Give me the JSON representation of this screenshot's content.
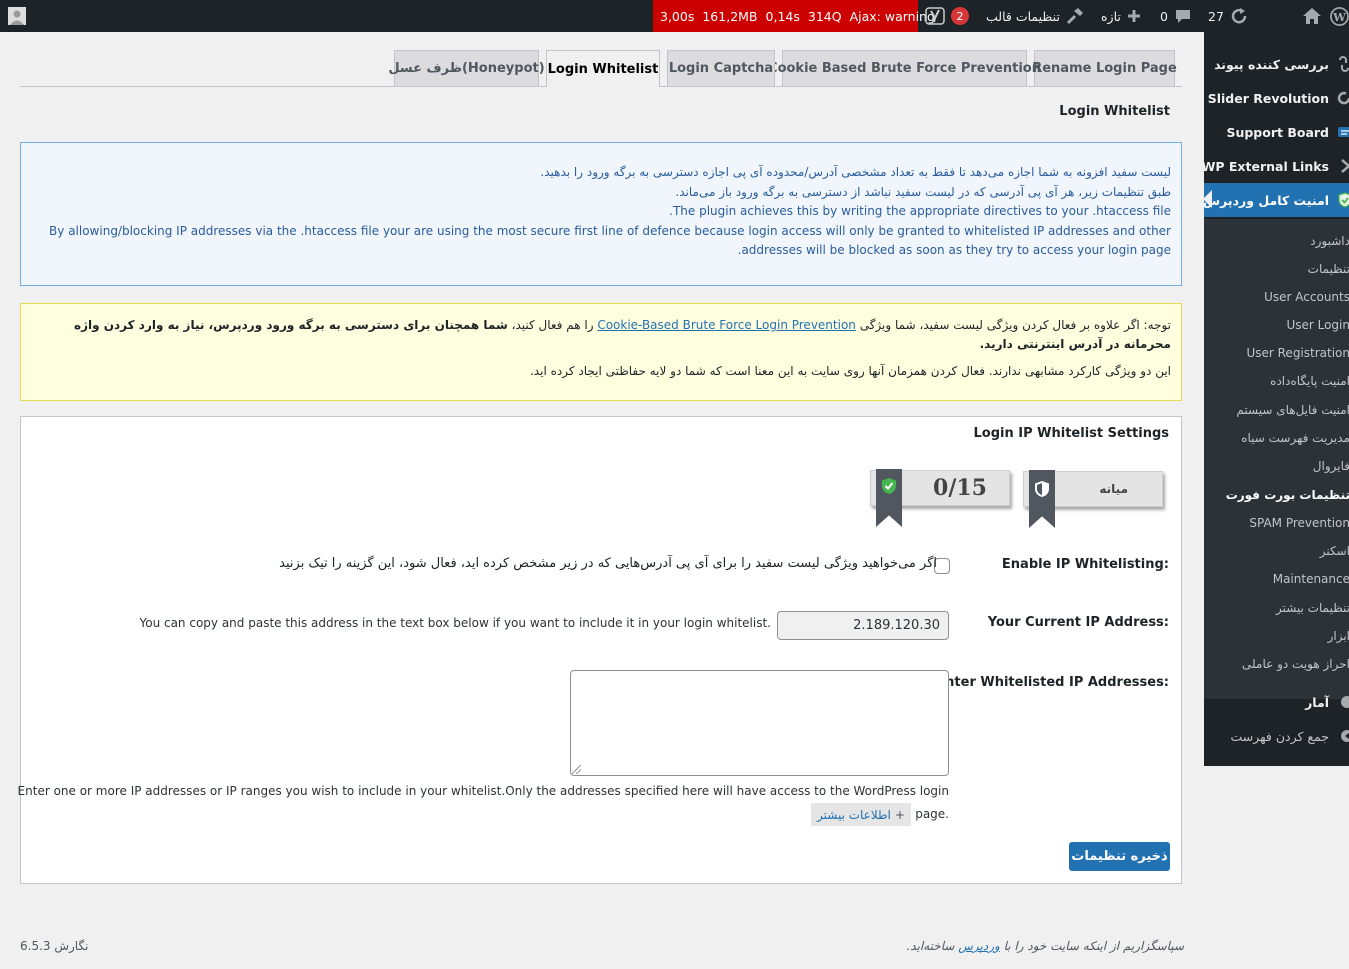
{
  "adminbar": {
    "user_icon": "user-avatar-icon",
    "qm": {
      "time": "3,00s",
      "memory": "161,2MB",
      "db_time": "0,14s",
      "queries": "314Q",
      "ajax": "Ajax: warning"
    },
    "yoast_count": "2",
    "theme_settings": "تنظیمات قالب",
    "new": "تازه",
    "comments_count": "0",
    "updates_count": "27"
  },
  "sidebar": {
    "items": [
      {
        "label": "بررسی کننده پیوند"
      },
      {
        "label": "Slider Revolution"
      },
      {
        "label": "Support Board"
      },
      {
        "label": "WP External Links"
      },
      {
        "label": "امنیت کامل وردپرس"
      }
    ],
    "submenu": [
      {
        "label": "داشبورد"
      },
      {
        "label": "تنظیمات"
      },
      {
        "label": "User Accounts"
      },
      {
        "label": "User Login"
      },
      {
        "label": "User Registration"
      },
      {
        "label": "امنیت پایگاه‌داده"
      },
      {
        "label": "امنیت فایل‌های سیستم"
      },
      {
        "label": "مدیریت فهرست سیاه"
      },
      {
        "label": "فایروال"
      },
      {
        "label": "تنظیمات بورت فورت"
      },
      {
        "label": "SPAM Prevention"
      },
      {
        "label": "اسکنر"
      },
      {
        "label": "Maintenance"
      },
      {
        "label": "تنظیمات بیشتر"
      },
      {
        "label": "ابزار"
      },
      {
        "label": "احراز هویت دو عاملی"
      }
    ],
    "bottom": [
      {
        "label": "آمار"
      },
      {
        "label": "جمع کردن فهرست"
      }
    ]
  },
  "tabs": [
    {
      "label": "Rename Login Page"
    },
    {
      "label": "Cookie Based Brute Force Prevention"
    },
    {
      "label": "Login Captcha"
    },
    {
      "label": "Login Whitelist"
    },
    {
      "label": "ظرف عسل(Honeypot)"
    }
  ],
  "section_title": "Login Whitelist",
  "info": {
    "line1": "لیست سفید افزونه به شما اجازه می‌دهد تا فقط به تعداد مشخصی آدرس/محدوده آی پی اجازه دسترسی به برگه ورود را بدهید.",
    "line2": "طبق تنظیمات زیر، هر آی پی آدرسی که در لیست سفید نباشد از دسترسی به برگه ورود باز می‌ماند.",
    "line3": "The plugin achieves this by writing the appropriate directives to your .htaccess file.",
    "line4": "By allowing/blocking IP addresses via the .htaccess file your are using the most secure first line of defence because login access will only be granted to whitelisted IP addresses and other addresses will be blocked as soon as they try to access your login page."
  },
  "note": {
    "prefix": "توجه: اگر علاوه بر فعال کردن ویژگی لیست سفید، شما ویژگی ",
    "link": "Cookie-Based Brute Force Login Prevention",
    "middle": " را هم فعال کنید، ",
    "bold": "شما همچنان برای دسترسی به برگه ورود وردپرس، نیاز به وارد کردن واژه محرمانه در آدرس اینترنتی دارید.",
    "line2": "این دو ویژگی کارکرد مشابهی ندارند. فعال کردن همزمان آنها روی سایت به این معنا است که شما دو لایه حفاظتی ایجاد کرده اید."
  },
  "panel": {
    "title": "Login IP Whitelist Settings",
    "score": "0/15",
    "level": "میانه",
    "enable_label": "Enable IP Whitelisting:",
    "enable_desc": "اگر می‌خواهید ویژگی لیست سفید را برای آی پی آدرس‌هایی که در زیر مشخص کرده اید، فعال شود، این گزینه را تیک بزنید",
    "current_ip_label": "Your Current IP Address:",
    "current_ip": "2.189.120.30",
    "current_ip_desc": "You can copy and paste this address in the text box below if you want to include it in your login whitelist.",
    "whitelist_label": "Enter Whitelisted IP Addresses:",
    "whitelist_value": "",
    "help_line1": "Enter one or more IP addresses or IP ranges you wish to include in your whitelist.Only the addresses specified here will have access to the WordPress login",
    "help_line2": "page.",
    "more_info": "اطلاعات بیشتر",
    "more_plus": "+",
    "save": "ذخیره تنظیمات"
  },
  "footer": {
    "thanks_prefix": "سپاسگزاریم از اینکه سایت خود را با ",
    "thanks_link": "وردپرس",
    "thanks_suffix": " ساخته‌اید.",
    "version": "نگارش 6.5.3"
  },
  "colors": {
    "primary": "#2271b1",
    "adminbar": "#1d2327",
    "qm_red": "#cc0000",
    "info_bg": "#f0f6fc",
    "note_bg": "#ffffe0"
  }
}
